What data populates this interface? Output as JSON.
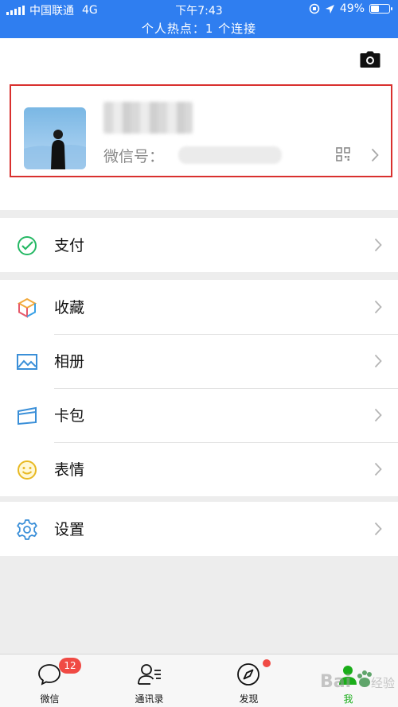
{
  "status_bar": {
    "carrier": "中国联通",
    "network": "4G",
    "time": "下午7:43",
    "battery": "49%",
    "battery_level": 0.49,
    "hotspot": "个人热点：1 个连接"
  },
  "profile": {
    "wechat_id_label": "微信号："
  },
  "menu_groups": [
    [
      {
        "label": "支付",
        "icon": "wallet-icon"
      }
    ],
    [
      {
        "label": "收藏",
        "icon": "favorites-cube-icon"
      },
      {
        "label": "相册",
        "icon": "album-icon"
      },
      {
        "label": "卡包",
        "icon": "card-pack-icon"
      },
      {
        "label": "表情",
        "icon": "emoji-icon"
      }
    ],
    [
      {
        "label": "设置",
        "icon": "settings-gear-icon"
      }
    ]
  ],
  "tabs": [
    {
      "label": "微信",
      "icon": "chat-bubble-icon",
      "badge": "12"
    },
    {
      "label": "通讯录",
      "icon": "contacts-icon"
    },
    {
      "label": "发现",
      "icon": "compass-icon"
    },
    {
      "label": "我",
      "icon": "me-icon",
      "active": true
    }
  ],
  "watermark": {
    "text": "Bai 经验",
    "logo": "baidu-paw-icon"
  },
  "colors": {
    "status_bar": "#2f7ef0",
    "highlight_border": "#d9302e",
    "badge": "#f04a44",
    "active_tab": "#1aad19"
  }
}
